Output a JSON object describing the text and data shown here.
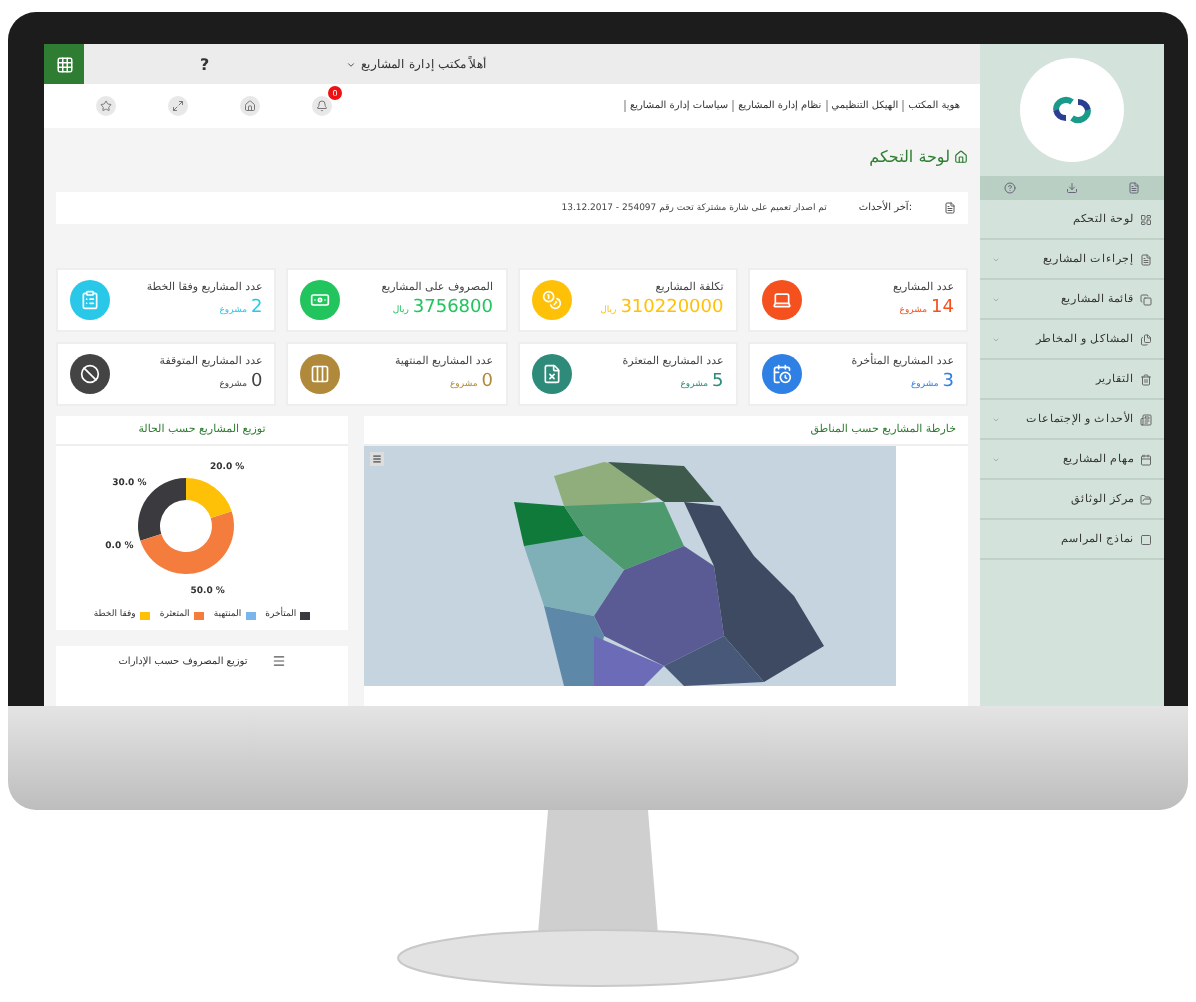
{
  "topbar": {
    "help": "?",
    "greeting": "أهلاً مكتب إدارة المشاريع",
    "notifications": "0"
  },
  "links": [
    "هوية المكتب",
    "الهيكل التنظيمي",
    "نظام إدارة المشاريع",
    "سياسات إدارة المشاريع"
  ],
  "page_title": "لوحة التحكم",
  "news": {
    "label": "آخر الأحداث:",
    "text": "تم اصدار تعميم على شارة مشتركة تحت رقم 254097 - 13.12.2017"
  },
  "cards": [
    {
      "title": "عدد المشاريع",
      "value": "14",
      "unit": "مشروع",
      "color": "#f4511e"
    },
    {
      "title": "تكلفة المشاريع",
      "value": "310220000",
      "unit": "ريال",
      "color": "#ffc107"
    },
    {
      "title": "المصروف على المشاريع",
      "value": "3756800",
      "unit": "ريال",
      "color": "#21c45d"
    },
    {
      "title": "عدد المشاريع وفقا الخطة",
      "value": "2",
      "unit": "مشروع",
      "color": "#29c7e8"
    },
    {
      "title": "عدد المشاريع المتأخرة",
      "value": "3",
      "unit": "مشروع",
      "color": "#2f80e4"
    },
    {
      "title": "عدد المشاريع المتعثرة",
      "value": "5",
      "unit": "مشروع",
      "color": "#2e8b7a"
    },
    {
      "title": "عدد المشاريع المنتهية",
      "value": "0",
      "unit": "مشروع",
      "color": "#b08a3a"
    },
    {
      "title": "عدد المشاريع المتوقفة",
      "value": "0",
      "unit": "مشروع",
      "color": "#444444"
    }
  ],
  "status_chart": {
    "title": "توزيع المشاريع حسب الحالة",
    "chart_data": {
      "type": "donut",
      "categories": [
        "المتأخرة",
        "المنتهية",
        "المتعثرة",
        "وفقا الخطة"
      ],
      "values": [
        30,
        0,
        50,
        20
      ],
      "value_labels": [
        "30.0 %",
        "0.0 %",
        "50.0 %",
        "20.0 %"
      ]
    },
    "legend": [
      {
        "color": "#3a3a3f"
      },
      {
        "color": "#7cb5ec"
      },
      {
        "color": "#f47c3c"
      },
      {
        "color": "#ffc107"
      }
    ]
  },
  "spend_chart": {
    "title": "توزيع المصروف حسب الإدارات"
  },
  "map": {
    "title": "خارطة المشاريع حسب المناطق"
  },
  "sidebar": [
    {
      "label": "لوحة التحكم",
      "expandable": false
    },
    {
      "label": "إجراءات المشاريع",
      "expandable": true
    },
    {
      "label": "قائمة المشاريع",
      "expandable": true
    },
    {
      "label": "المشاكل و المخاطر",
      "expandable": true
    },
    {
      "label": "التقارير",
      "expandable": false
    },
    {
      "label": "الأحداث و الإجتماعات",
      "expandable": true
    },
    {
      "label": "مهام المشاريع",
      "expandable": true
    },
    {
      "label": "مركز الوثائق",
      "expandable": false
    },
    {
      "label": "نماذج المراسم",
      "expandable": false
    }
  ]
}
